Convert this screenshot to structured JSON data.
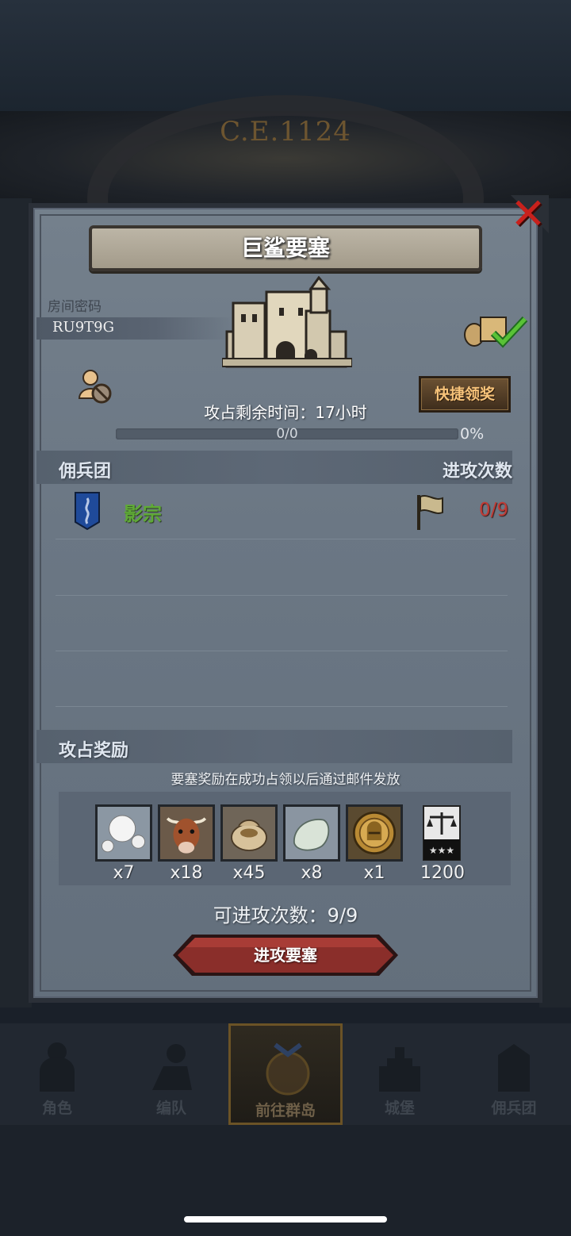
{
  "header": {
    "year": "C.E.1124"
  },
  "dialog": {
    "title": "巨鲨要塞",
    "room_label": "房间密码",
    "room_code": "RU9T9G",
    "quick_claim_label": "快捷领奖",
    "remaining_time": "攻占剩余时间：17小时",
    "progress": {
      "text": "0/0",
      "percent_label": "0%",
      "fraction": 0
    },
    "mercenary_section": {
      "title": "佣兵团",
      "right_title": "进攻次数"
    },
    "mercenaries": [
      {
        "name": "影宗",
        "attacks": "0/9",
        "name_color": "#5faa37"
      }
    ],
    "reward_section": {
      "title": "攻占奖励",
      "note": "要塞奖励在成功占领以后通过邮件发放"
    },
    "rewards": [
      {
        "icon": "pearl-icon",
        "count": "x7"
      },
      {
        "icon": "cattle-icon",
        "count": "x18"
      },
      {
        "icon": "sack-icon",
        "count": "x45"
      },
      {
        "icon": "stone-icon",
        "count": "x8"
      },
      {
        "icon": "knight-medal-icon",
        "count": "x1"
      },
      {
        "icon": "justice-banner-icon",
        "count": "1200"
      }
    ],
    "remaining_attacks": "可进攻次数：9/9",
    "attack_button_label": "进攻要塞"
  },
  "bottom_nav": {
    "items": [
      {
        "label": "角色",
        "icon": "character-icon",
        "active": false
      },
      {
        "label": "编队",
        "icon": "formation-icon",
        "active": false
      },
      {
        "label": "前往群岛",
        "icon": "islands-icon",
        "active": true
      },
      {
        "label": "城堡",
        "icon": "castle-nav-icon",
        "active": false
      },
      {
        "label": "佣兵团",
        "icon": "mercenary-icon",
        "active": false
      }
    ]
  },
  "colors": {
    "accent_gold": "#f7c37a",
    "danger_red": "#c13b35",
    "merc_green": "#5faa37"
  }
}
